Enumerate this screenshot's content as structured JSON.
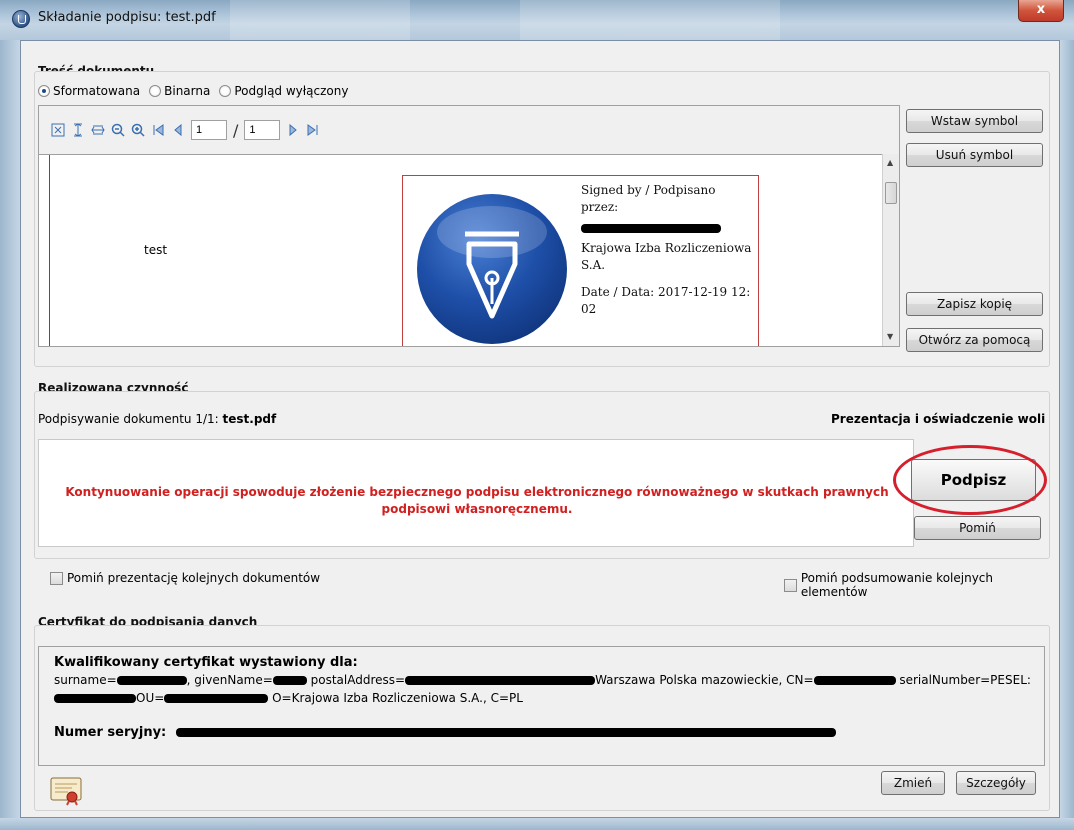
{
  "window": {
    "title": "Składanie podpisu: test.pdf",
    "close_glyph": "x"
  },
  "document": {
    "group_title": "Treść dokumentu",
    "radios": [
      {
        "label": "Sformatowana",
        "selected": true
      },
      {
        "label": "Binarna",
        "selected": false
      },
      {
        "label": "Podgląd wyłączony",
        "selected": false
      }
    ],
    "toolbar": {
      "page_current": "1",
      "page_total": "1",
      "separator": "/"
    },
    "page_text": "test",
    "signature": {
      "line1": "Signed by / Podpisano przez:",
      "line2": "Krajowa Izba Rozliczeniowa S.A.",
      "line3": "Date / Data: 2017-12-19 12: 02"
    },
    "buttons": {
      "insert_symbol": "Wstaw symbol",
      "remove_symbol": "Usuń symbol",
      "save_copy": "Zapisz kopię",
      "open_with": "Otwórz za pomocą"
    }
  },
  "action": {
    "group_title": "Realizowana czynność",
    "progress_prefix": "Podpisywanie dokumentu 1/1: ",
    "progress_file": "test.pdf",
    "right_label": "Prezentacja i oświadczenie woli",
    "warning": "Kontynuowanie operacji spowoduje złożenie bezpiecznego podpisu elektronicznego równoważnego w skutkach prawnych podpisowi własnoręcznemu.",
    "sign_button": "Podpisz",
    "skip_button": "Pomiń",
    "highlight_color": "#d61f2c",
    "warning_color": "#d02020"
  },
  "options": {
    "skip_presentation": "Pomiń prezentację kolejnych dokumentów",
    "skip_summary": "Pomiń podsumowanie kolejnych elementów"
  },
  "certificate": {
    "group_title": "Certyfikat do podpisania danych",
    "heading": "Kwalifikowany certyfikat wystawiony dla:",
    "line1_a": "surname=",
    "line1_b": ", givenName=",
    "line1_c": " postalAddress=",
    "line1_d": "Warszawa Polska mazowieckie, CN=",
    "line1_e": " serialNumber=PESEL:",
    "line2_a": "OU=",
    "line2_b": " O=Krajowa Izba Rozliczeniowa S.A., C=PL",
    "serial_label": "Numer seryjny:",
    "change_button": "Zmień",
    "details_button": "Szczegóły"
  }
}
